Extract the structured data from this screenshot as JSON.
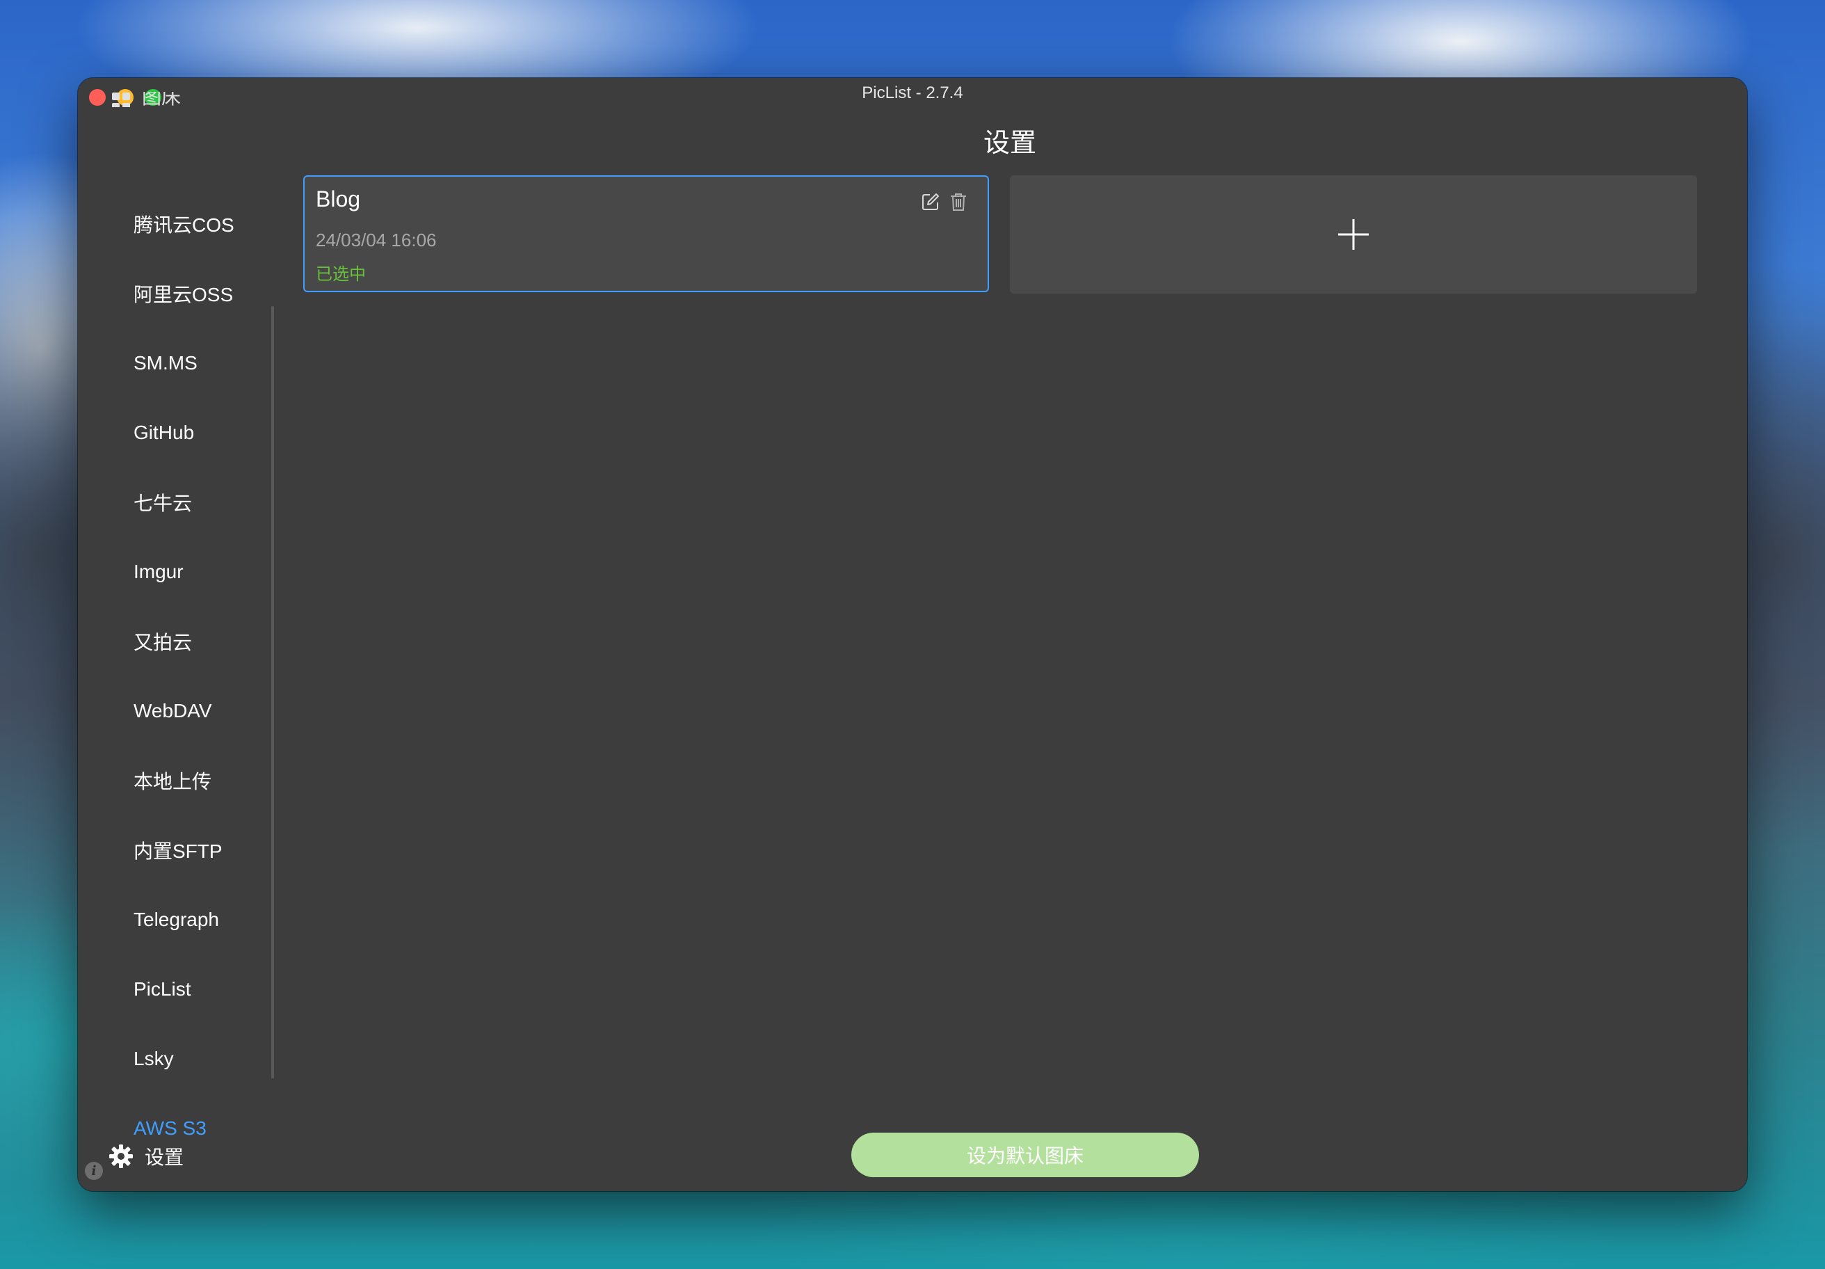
{
  "window": {
    "title": "PicList - 2.7.4",
    "partial_top_item_label": "图床"
  },
  "page": {
    "title": "设置"
  },
  "sidebar": {
    "items": [
      {
        "label": "腾讯云COS",
        "active": false
      },
      {
        "label": "阿里云OSS",
        "active": false
      },
      {
        "label": "SM.MS",
        "active": false
      },
      {
        "label": "GitHub",
        "active": false
      },
      {
        "label": "七牛云",
        "active": false
      },
      {
        "label": "Imgur",
        "active": false
      },
      {
        "label": "又拍云",
        "active": false
      },
      {
        "label": "WebDAV",
        "active": false
      },
      {
        "label": "本地上传",
        "active": false
      },
      {
        "label": "内置SFTP",
        "active": false
      },
      {
        "label": "Telegraph",
        "active": false
      },
      {
        "label": "PicList",
        "active": false
      },
      {
        "label": "Lsky",
        "active": false
      },
      {
        "label": "AWS S3",
        "active": true
      }
    ],
    "settings_label": "设置",
    "info_glyph": "i"
  },
  "config_card": {
    "name": "Blog",
    "date": "24/03/04 16:06",
    "status": "已选中",
    "edit_icon": "edit-icon",
    "delete_icon": "trash-icon"
  },
  "add_card": {
    "icon": "plus-icon"
  },
  "default_button": {
    "label": "设为默认图床"
  },
  "colors": {
    "accent": "#409eff",
    "selected_status": "#67c23a",
    "default_button_bg": "#b3e19d",
    "window_bg": "#3d3d3d"
  }
}
